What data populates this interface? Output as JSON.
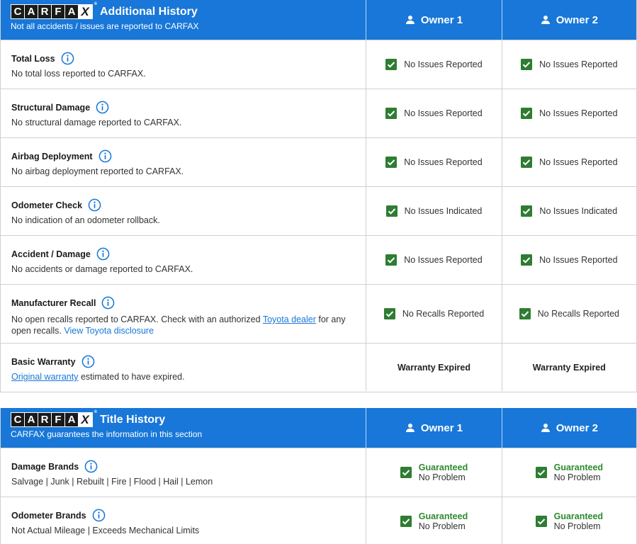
{
  "colors": {
    "header_bg": "#1877d8",
    "check_green": "#2e7d32",
    "guaranteed_green": "#2e8a2e",
    "link": "#1877d8"
  },
  "logo": {
    "letters": [
      "C",
      "A",
      "R",
      "F",
      "A",
      "X"
    ],
    "reg": "®"
  },
  "additional": {
    "title": "Additional History",
    "subtitle": "Not all accidents / issues are reported to CARFAX",
    "owners": [
      "Owner 1",
      "Owner 2"
    ],
    "rows": [
      {
        "label": "Total Loss",
        "desc": "No total loss reported to CARFAX.",
        "owner1": "No Issues Reported",
        "owner2": "No Issues Reported"
      },
      {
        "label": "Structural Damage",
        "desc": "No structural damage reported to CARFAX.",
        "owner1": "No Issues Reported",
        "owner2": "No Issues Reported"
      },
      {
        "label": "Airbag Deployment",
        "desc": "No airbag deployment reported to CARFAX.",
        "owner1": "No Issues Reported",
        "owner2": "No Issues Reported"
      },
      {
        "label": "Odometer Check",
        "desc": "No indication of an odometer rollback.",
        "owner1": "No Issues Indicated",
        "owner2": "No Issues Indicated"
      },
      {
        "label": "Accident / Damage",
        "desc": "No accidents or damage reported to CARFAX.",
        "owner1": "No Issues Reported",
        "owner2": "No Issues Reported"
      },
      {
        "label": "Manufacturer Recall",
        "desc_pre": "No open recalls reported to CARFAX. Check with an authorized ",
        "desc_link": "Toyota dealer",
        "desc_mid": " for any open recalls. ",
        "desc_link2": "View Toyota disclosure",
        "owner1": "No Recalls Reported",
        "owner2": "No Recalls Reported"
      },
      {
        "label": "Basic Warranty",
        "desc_link": "Original warranty",
        "desc_post": " estimated to have expired.",
        "owner1": "Warranty Expired",
        "owner2": "Warranty Expired"
      }
    ]
  },
  "title_history": {
    "title": "Title History",
    "subtitle": "CARFAX guarantees the information in this section",
    "owners": [
      "Owner 1",
      "Owner 2"
    ],
    "rows": [
      {
        "label": "Damage Brands",
        "desc": "Salvage | Junk | Rebuilt | Fire | Flood | Hail | Lemon",
        "status_title": "Guaranteed",
        "status_sub": "No Problem"
      },
      {
        "label": "Odometer Brands",
        "desc": "Not Actual Mileage | Exceeds Mechanical Limits",
        "status_title": "Guaranteed",
        "status_sub": "No Problem"
      }
    ]
  }
}
